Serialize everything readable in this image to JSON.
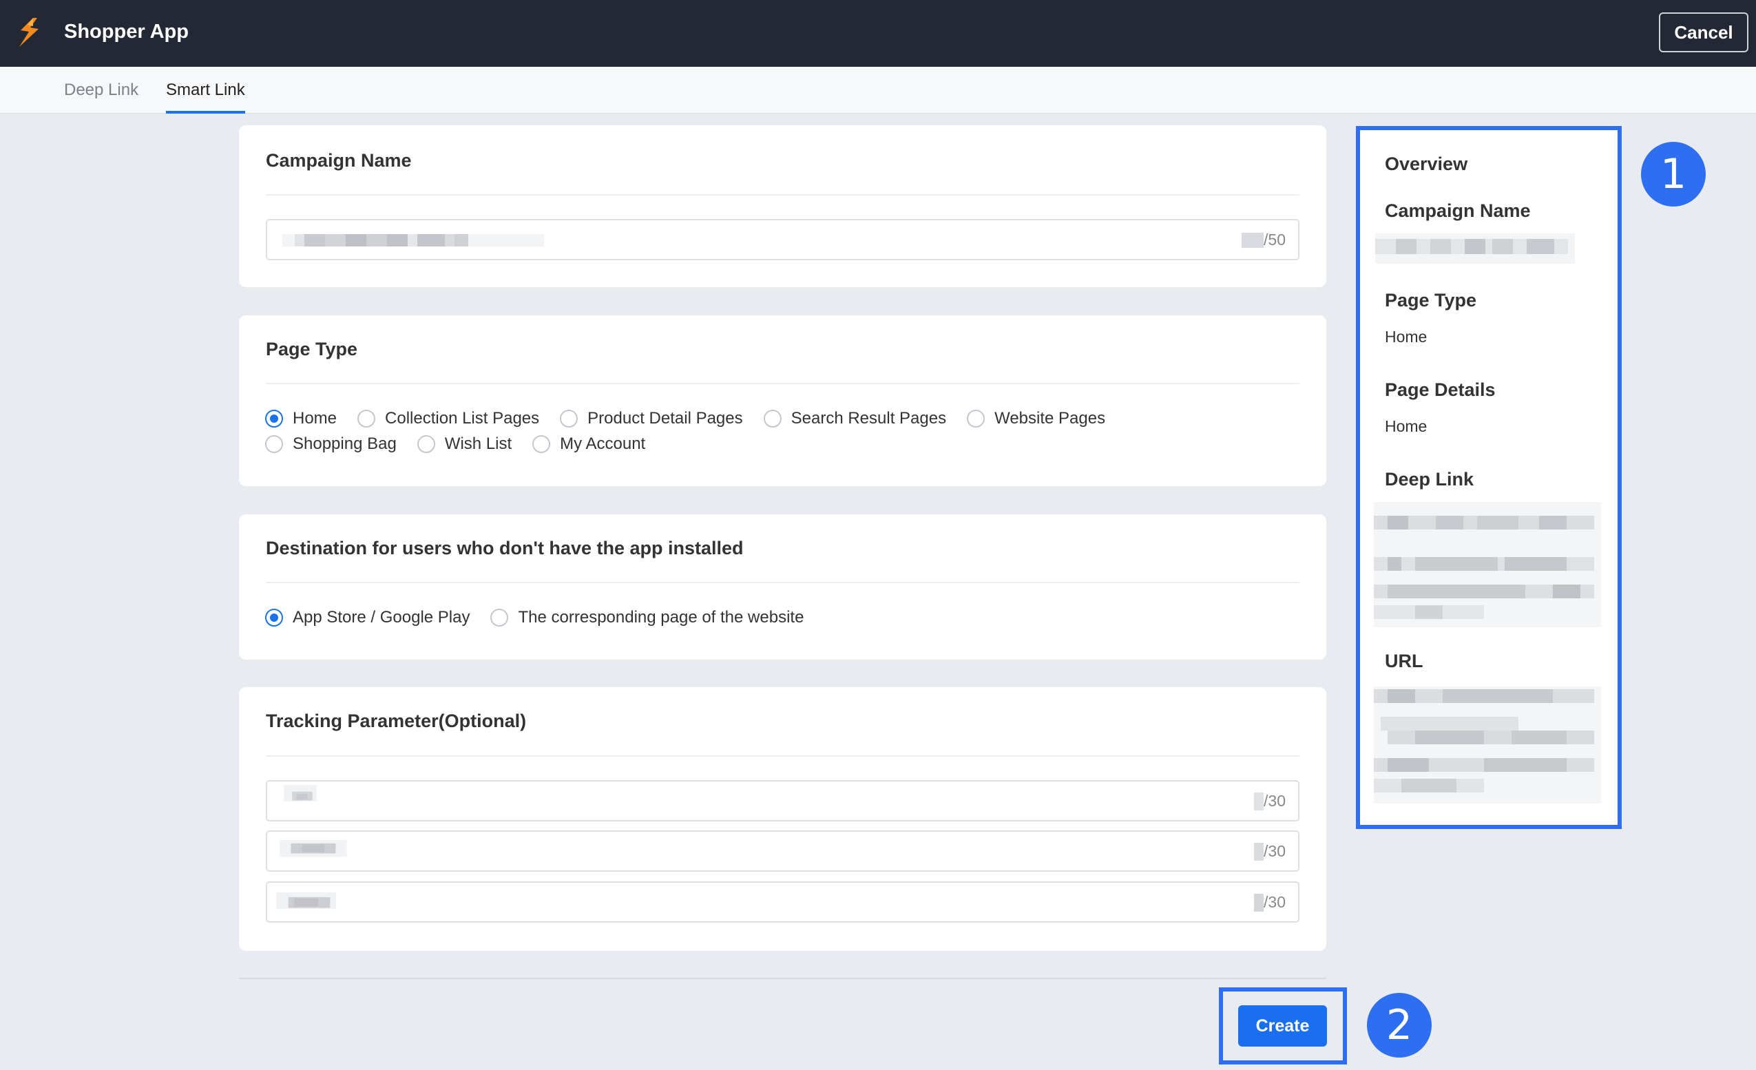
{
  "header": {
    "app_title": "Shopper App",
    "cancel_label": "Cancel",
    "logo_icon": "shopper-logo-icon"
  },
  "tabs": [
    {
      "label": "Deep Link",
      "active": false
    },
    {
      "label": "Smart Link",
      "active": true
    }
  ],
  "campaign": {
    "title": "Campaign Name",
    "counter_suffix": "/50"
  },
  "page_type": {
    "title": "Page Type",
    "options_row1": [
      "Home",
      "Collection List Pages",
      "Product Detail Pages",
      "Search Result Pages",
      "Website Pages"
    ],
    "options_row2": [
      "Shopping Bag",
      "Wish List",
      "My Account"
    ],
    "selected": "Home"
  },
  "destination": {
    "title": "Destination for users who don't have the app installed",
    "options": [
      "App Store / Google Play",
      "The corresponding page of the website"
    ],
    "selected": "App Store / Google Play"
  },
  "tracking": {
    "title": "Tracking Parameter(Optional)",
    "fields": [
      {
        "counter_suffix": "/30"
      },
      {
        "counter_suffix": "/30"
      },
      {
        "counter_suffix": "/30"
      }
    ]
  },
  "overview": {
    "title": "Overview",
    "campaign_label": "Campaign Name",
    "page_type_label": "Page Type",
    "page_type_value": "Home",
    "page_details_label": "Page Details",
    "page_details_value": "Home",
    "deep_link_label": "Deep Link",
    "url_label": "URL"
  },
  "actions": {
    "create_label": "Create"
  },
  "annotations": {
    "badge_1": "1",
    "badge_2": "2"
  },
  "colors": {
    "accent": "#1a73e8",
    "annotation": "#2e6ef0",
    "topbar": "#222834"
  }
}
